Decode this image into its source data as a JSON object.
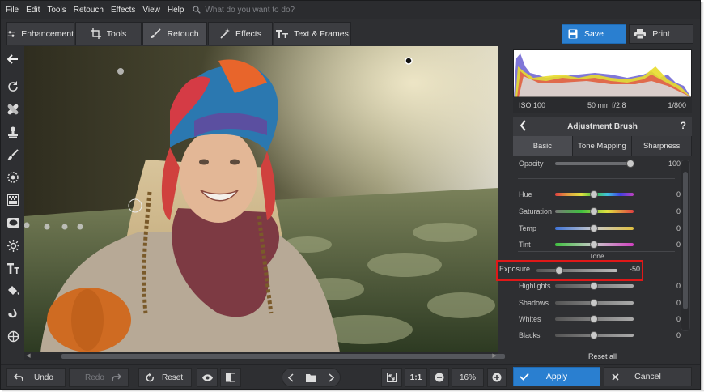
{
  "menu": {
    "items": [
      "File",
      "Edit",
      "Tools",
      "Retouch",
      "Effects",
      "View",
      "Help"
    ],
    "search_placeholder": "What do you want to do?"
  },
  "toolbar": {
    "tabs": [
      {
        "label": "Enhancement",
        "icon": "sliders-icon"
      },
      {
        "label": "Tools",
        "icon": "crop-icon"
      },
      {
        "label": "Retouch",
        "icon": "brush-icon",
        "active": true
      },
      {
        "label": "Effects",
        "icon": "magic-wand-icon"
      },
      {
        "label": "Text & Frames",
        "icon": "text-icon"
      }
    ],
    "save_label": "Save",
    "print_label": "Print"
  },
  "histogram": {
    "iso": "ISO 100",
    "lens": "50 mm f/2.8",
    "shutter": "1/800"
  },
  "adjustment_brush": {
    "title": "Adjustment Brush",
    "help": "?",
    "tabs": [
      "Basic",
      "Tone Mapping",
      "Sharpness"
    ],
    "active_tab": "Basic",
    "opacity": {
      "label": "Opacity",
      "value": "100",
      "level": 1.0
    },
    "color_rows": [
      {
        "label": "Hue",
        "value": "0",
        "level": 0.5
      },
      {
        "label": "Saturation",
        "value": "0",
        "level": 0.5
      },
      {
        "label": "Temp",
        "value": "0",
        "level": 0.5
      },
      {
        "label": "Tint",
        "value": "0",
        "level": 0.5
      }
    ],
    "tone_label": "Tone",
    "exposure": {
      "label": "Exposure",
      "value": "-50",
      "level": 0.25
    },
    "tone_rows": [
      {
        "label": "Highlights",
        "value": "0",
        "level": 0.5
      },
      {
        "label": "Shadows",
        "value": "0",
        "level": 0.5
      },
      {
        "label": "Whites",
        "value": "0",
        "level": 0.5
      },
      {
        "label": "Blacks",
        "value": "0",
        "level": 0.5
      }
    ],
    "reset_all": "Reset all"
  },
  "bottom": {
    "undo": "Undo",
    "redo": "Redo",
    "reset": "Reset",
    "zoom_1to1": "1:1",
    "zoom_value": "16%",
    "apply": "Apply",
    "cancel": "Cancel"
  },
  "colors": {
    "accent": "#2a7fd0",
    "highlight_box": "#e01818",
    "panel_bg": "#2e2f32"
  }
}
